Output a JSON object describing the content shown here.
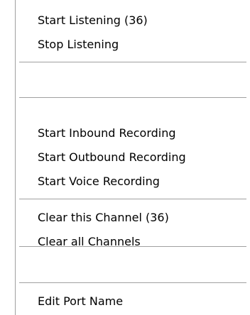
{
  "context_menu": {
    "items": [
      {
        "label": "Start Listening (36)"
      },
      {
        "label": "Stop Listening"
      },
      {
        "label": "Start Inbound Recording"
      },
      {
        "label": "Start Outbound Recording"
      },
      {
        "label": "Start Voice Recording"
      },
      {
        "label": "Clear this Channel (36)"
      },
      {
        "label": "Clear all Channels"
      },
      {
        "label": "Edit Port Name"
      }
    ]
  }
}
